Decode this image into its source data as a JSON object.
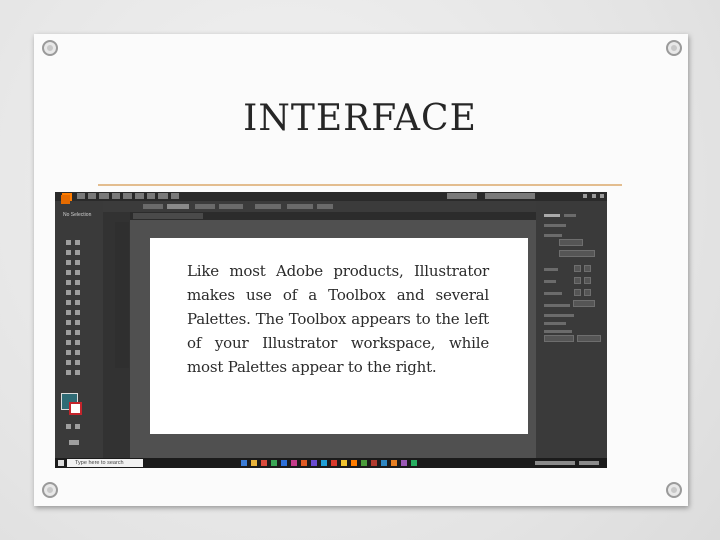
{
  "slide": {
    "title": "INTERFACE",
    "body": "Like most Adobe products, Illustrator makes use of a Toolbox and several Palettes. The Toolbox appears to the left of your Illustrator workspace, while most Palettes appear to the right.",
    "colors": {
      "rule": "#e3bd8f",
      "card": "#fbfbfb",
      "title": "#262626"
    }
  },
  "screenshot": {
    "app": "Adobe Illustrator",
    "left_panel_status": "No Selection",
    "taskbar_search_placeholder": "Type here to search",
    "colors": {
      "app_background": "#323232",
      "fill_swatch": "#2f6b75",
      "stroke_swatch": "#c4242b",
      "logo": "#ff7c00"
    },
    "icons": [
      "illustrator-logo-icon",
      "selection-tool-icon",
      "pen-tool-icon",
      "type-tool-icon",
      "windows-start-icon"
    ]
  }
}
